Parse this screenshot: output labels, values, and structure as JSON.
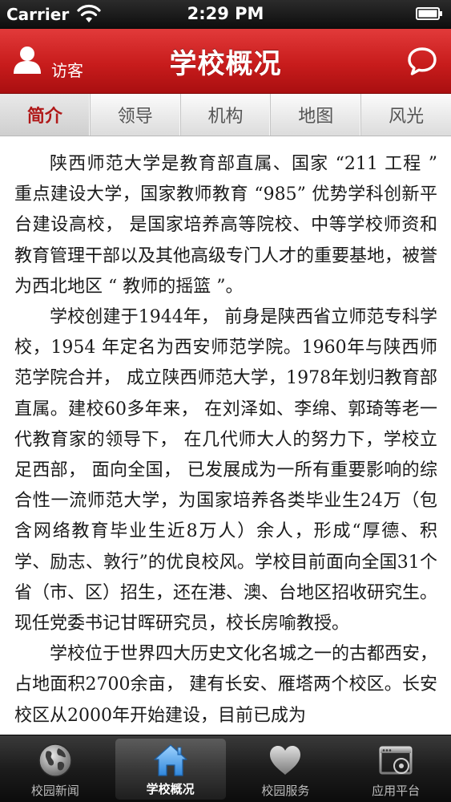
{
  "status_bar": {
    "carrier": "Carrier",
    "time": "2:29 PM"
  },
  "header": {
    "user_label": "访客",
    "title": "学校概况",
    "user_icon": "user-icon",
    "chat_icon": "chat-bubble-icon"
  },
  "tabs": [
    {
      "label": "简介",
      "active": true
    },
    {
      "label": "领导",
      "active": false
    },
    {
      "label": "机构",
      "active": false
    },
    {
      "label": "地图",
      "active": false
    },
    {
      "label": "风光",
      "active": false
    }
  ],
  "content": {
    "paragraphs": [
      "陕西师范大学是教育部直属、国家 “211 工程 ” 重点建设大学，国家教师教育 “985” 优势学科创新平台建设高校， 是国家培养高等院校、中等学校师资和教育管理干部以及其他高级专门人才的重要基地，被誉为西北地区 “ 教师的摇篮 ”。",
      "学校创建于1944年， 前身是陕西省立师范专科学校，1954 年定名为西安师范学院。1960年与陕西师范学院合并， 成立陕西师范大学，1978年划归教育部直属。建校60多年来， 在刘泽如、李绵、郭琦等老一代教育家的领导下， 在几代师大人的努力下，学校立足西部， 面向全国， 已发展成为一所有重要影响的综合性一流师范大学，为国家培养各类毕业生24万（包含网络教育毕业生近8万人）余人，形成“厚德、积学、励志、敦行”的优良校风。学校目前面向全国31个省（市、区）招生，还在港、澳、台地区招收研究生。现任党委书记甘晖研究员，校长房喻教授。",
      "学校位于世界四大历史文化名城之一的古都西安， 占地面积2700余亩， 建有长安、雁塔两个校区。长安校区从2000年开始建设，目前已成为"
    ]
  },
  "bottom_tabs": [
    {
      "label": "校园新闻",
      "icon": "globe-icon",
      "active": false
    },
    {
      "label": "学校概况",
      "icon": "home-icon",
      "active": true
    },
    {
      "label": "校园服务",
      "icon": "heart-icon",
      "active": false
    },
    {
      "label": "应用平台",
      "icon": "app-window-icon",
      "active": false
    }
  ],
  "colors": {
    "accent": "#c81c1c",
    "active_tab_text": "#b01818"
  }
}
